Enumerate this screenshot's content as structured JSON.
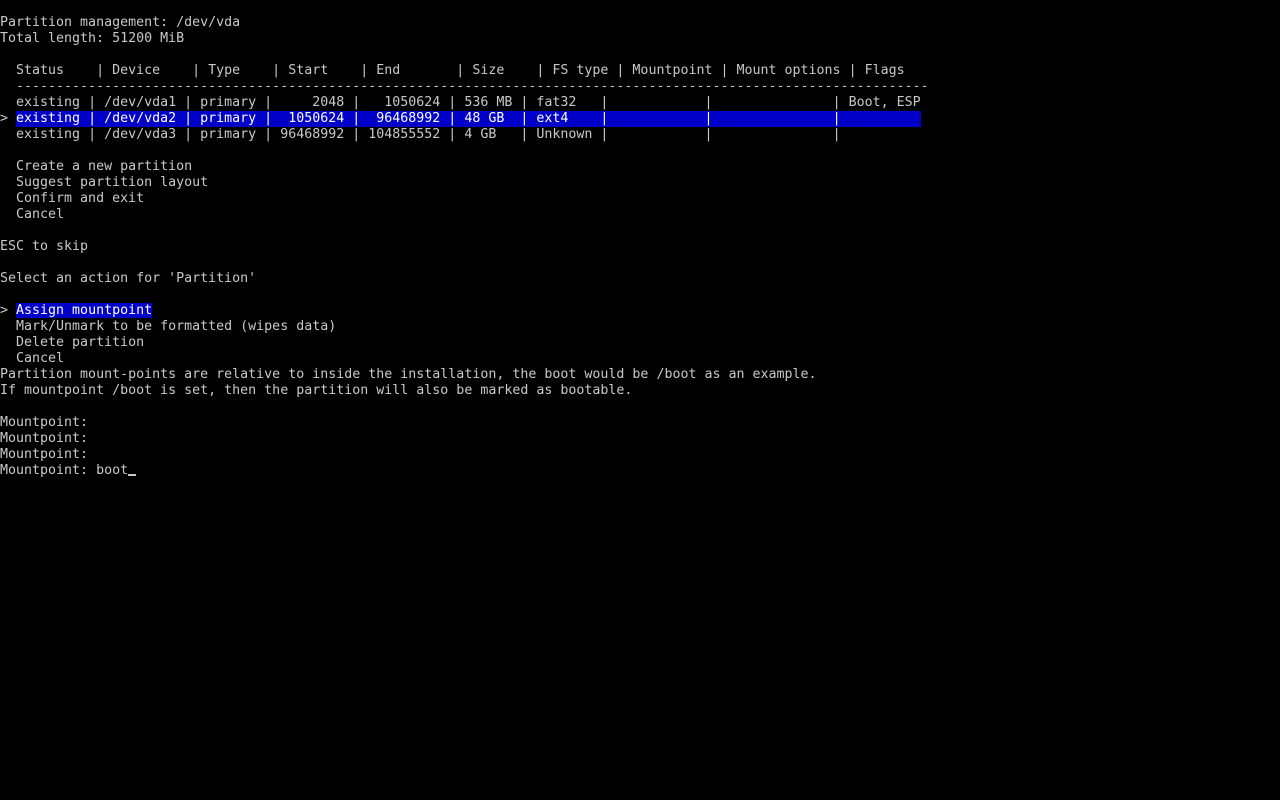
{
  "header": {
    "title": "Partition management: /dev/vda",
    "total": "Total length: 51200 MiB"
  },
  "table": {
    "header_row": "  Status    | Device    | Type    | Start    | End       | Size    | FS type | Mountpoint | Mount options | Flags",
    "separator": "  ------------------------------------------------------------------------------------------------------------------",
    "rows": [
      {
        "marker": "  ",
        "text": "existing | /dev/vda1 | primary |     2048 |   1050624 | 536 MB | fat32   |            |               | Boot, ESP"
      },
      {
        "marker": "> ",
        "text": "existing | /dev/vda2 | primary |  1050624 |  96468992 | 48 GB  | ext4    |            |               |          "
      },
      {
        "marker": "  ",
        "text": "existing | /dev/vda3 | primary | 96468992 | 104855552 | 4 GB   | Unknown |            |               |"
      }
    ]
  },
  "menu": [
    "  Create a new partition",
    "  Suggest partition layout",
    "  Confirm and exit",
    "  Cancel"
  ],
  "hint": "ESC to skip",
  "action_prompt": "Select an action for 'Partition'",
  "actions": {
    "selected_marker": "> ",
    "selected": "Assign mountpoint",
    "others": [
      "  Mark/Unmark to be formatted (wipes data)",
      "  Delete partition",
      "  Cancel"
    ]
  },
  "info": [
    "Partition mount-points are relative to inside the installation, the boot would be /boot as an example.",
    "If mountpoint /boot is set, then the partition will also be marked as bootable."
  ],
  "prompts": [
    "Mountpoint:",
    "Mountpoint:",
    "Mountpoint:"
  ],
  "input": {
    "label": "Mountpoint: ",
    "value": "boot"
  }
}
